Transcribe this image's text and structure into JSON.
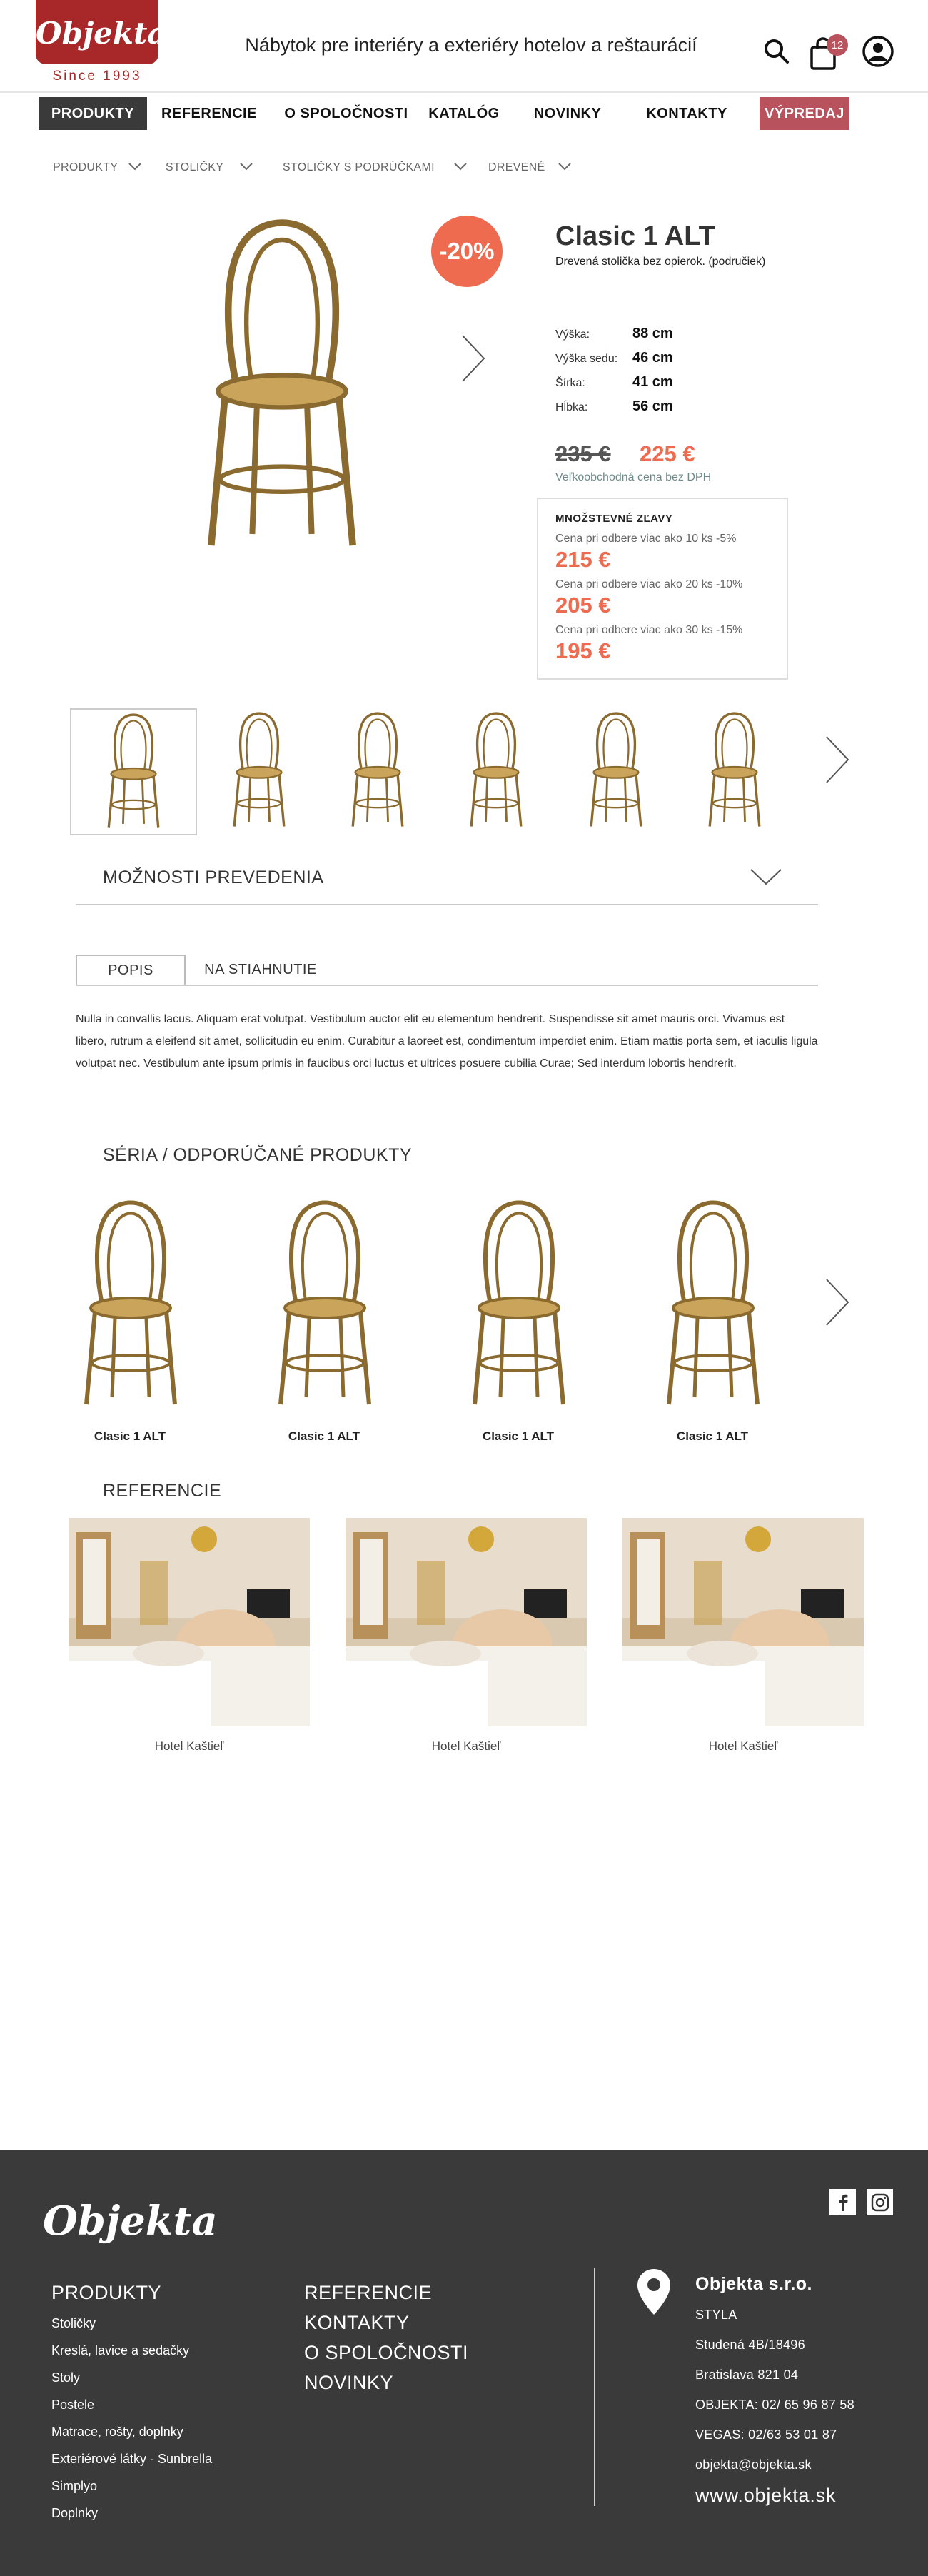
{
  "header": {
    "logo": "Objekta",
    "since": "Since 1993",
    "tagline": "Nábytok pre interiéry a exteriéry hotelov a reštaurácií",
    "cart_count": "12"
  },
  "nav": {
    "items": [
      "PRODUKTY",
      "REFERENCIE",
      "O SPOLOČNOSTI",
      "KATALÓG",
      "NOVINKY",
      "KONTAKTY",
      "VÝPREDAJ"
    ]
  },
  "breadcrumbs": [
    "PRODUKTY",
    "STOLIČKY",
    "STOLIČKY S PODRÚČKAMI",
    "DREVENÉ"
  ],
  "product": {
    "discount": "-20%",
    "title": "Clasic 1 ALT",
    "subtitle": "Drevená stolička bez opierok. (područiek)",
    "specs": [
      {
        "label": "Výška:",
        "value": "88 cm"
      },
      {
        "label": "Výška sedu:",
        "value": "46 cm"
      },
      {
        "label": "Šírka:",
        "value": "41 cm"
      },
      {
        "label": "Hĺbka:",
        "value": "56 cm"
      }
    ],
    "old_price": "235 €",
    "new_price": "225 €",
    "price_note": "Veľkoobchodná cena bez DPH",
    "quantity": {
      "title": "MNOŽSTEVNÉ ZĽAVY",
      "tiers": [
        {
          "text": "Cena pri odbere viac ako 10 ks -5%",
          "price": "215 €"
        },
        {
          "text": "Cena pri odbere viac ako 20 ks -10%",
          "price": "205 €"
        },
        {
          "text": "Cena pri odbere viac ako 30 ks -15%",
          "price": "195 €"
        }
      ]
    }
  },
  "options": {
    "title": "MOŽNOSTI PREVEDENIA"
  },
  "tabs": [
    "POPIS",
    "NA STIAHNUTIE"
  ],
  "description": "Nulla in convallis lacus. Aliquam erat volutpat. Vestibulum auctor elit eu elementum hendrerit. Suspendisse sit amet mauris orci. Vivamus est libero, rutrum a eleifend sit amet, sollicitudin eu enim. Curabitur a laoreet est, condimentum imperdiet enim. Etiam mattis porta sem, et iaculis ligula volutpat nec. Vestibulum ante ipsum primis in faucibus orci luctus et ultrices posuere cubilia Curae; Sed interdum lobortis hendrerit.",
  "series": {
    "title": "SÉRIA / ODPORÚČANÉ PRODUKTY",
    "items": [
      "Clasic 1 ALT",
      "Clasic 1 ALT",
      "Clasic 1 ALT",
      "Clasic 1 ALT"
    ]
  },
  "references": {
    "title": "REFERENCIE",
    "items": [
      "Hotel Kaštieľ",
      "Hotel Kaštieľ",
      "Hotel Kaštieľ"
    ]
  },
  "footer": {
    "logo": "Objekta",
    "products_title": "PRODUKTY",
    "product_links": [
      "Stoličky",
      "Kreslá, lavice a sedačky",
      "Stoly",
      "Postele",
      "Matrace, rošty, doplnky",
      "Exteriérové látky - Sunbrella",
      "Simplyo",
      "Doplnky"
    ],
    "menu": [
      "REFERENCIE",
      "KONTAKTY",
      "O SPOLOČNOSTI",
      "NOVINKY"
    ],
    "company": "Objekta s.r.o.",
    "info": [
      "STYLA",
      "Studená 4B/18496",
      "Bratislava 821 04",
      "OBJEKTA: 02/ 65 96 87 58",
      "VEGAS: 02/63 53 01 87",
      "objekta@objekta.sk"
    ],
    "web": "www.objekta.sk"
  },
  "colors": {
    "brand": "#a8282a",
    "accent": "#ee6b50",
    "sale": "#b8525c",
    "footer": "#3a3a3a"
  }
}
